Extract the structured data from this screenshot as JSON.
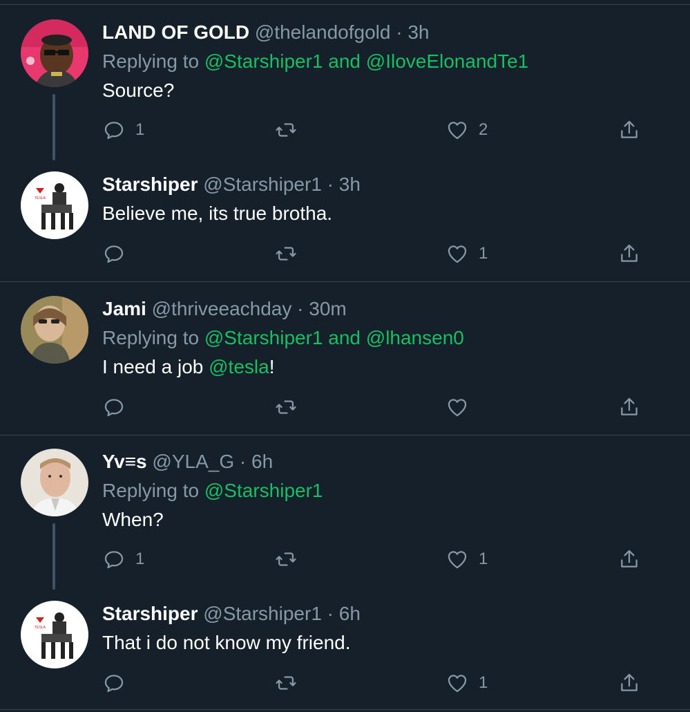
{
  "colors": {
    "background": "#15202b",
    "divider": "#38444d",
    "secondary_text": "#8899a6",
    "mention": "#17bf63",
    "thread_line": "#3d5466"
  },
  "icons": {
    "reply": "reply-icon",
    "retweet": "retweet-icon",
    "like": "heart-icon",
    "share": "share-icon"
  },
  "tweets": [
    {
      "name": "LAND OF GOLD",
      "handle": "@thelandofgold",
      "separator": "·",
      "time": "3h",
      "replying_prefix": "Replying to",
      "replying_to": [
        "@Starshiper1",
        "@IloveElonandTe1"
      ],
      "replying_joiner": "and",
      "text": "Source?",
      "replies": "1",
      "retweets": "",
      "likes": "2"
    },
    {
      "name": "Starshiper",
      "handle": "@Starshiper1",
      "separator": "·",
      "time": "3h",
      "text": "Believe me, its true brotha.",
      "replies": "",
      "retweets": "",
      "likes": "1"
    },
    {
      "name": "Jami",
      "handle": "@thriveeachday",
      "separator": "·",
      "time": "30m",
      "replying_prefix": "Replying to",
      "replying_to": [
        "@Starshiper1",
        "@lhansen0"
      ],
      "replying_joiner": "and",
      "text_before": "I need a job ",
      "text_mention": "@tesla",
      "text_after": "!",
      "replies": "",
      "retweets": "",
      "likes": ""
    },
    {
      "name": "Yv≡s",
      "handle": "@YLA_G",
      "separator": "·",
      "time": "6h",
      "replying_prefix": "Replying to",
      "replying_to": [
        "@Starshiper1"
      ],
      "text": "When?",
      "replies": "1",
      "retweets": "",
      "likes": "1"
    },
    {
      "name": "Starshiper",
      "handle": "@Starshiper1",
      "separator": "·",
      "time": "6h",
      "text": "That i do not know my friend.",
      "replies": "",
      "retweets": "",
      "likes": "1"
    }
  ]
}
